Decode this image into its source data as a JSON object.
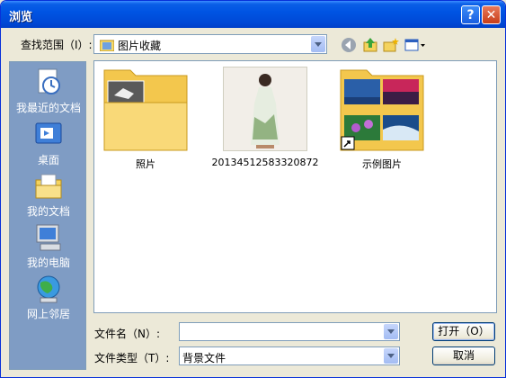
{
  "window": {
    "title": "浏览"
  },
  "titlebar": {
    "help": "?",
    "close": "✕"
  },
  "lookin": {
    "label": "查找范围（I）:",
    "value": "图片收藏"
  },
  "toolbar": {
    "icons": [
      "back-icon",
      "up-folder-icon",
      "new-folder-icon",
      "views-icon"
    ]
  },
  "places": [
    {
      "label": "我最近的文档",
      "icon": "recent-documents-icon"
    },
    {
      "label": "桌面",
      "icon": "desktop-icon"
    },
    {
      "label": "我的文档",
      "icon": "my-documents-icon"
    },
    {
      "label": "我的电脑",
      "icon": "my-computer-icon"
    },
    {
      "label": "网上邻居",
      "icon": "network-places-icon"
    }
  ],
  "items": [
    {
      "name": "照片",
      "type": "folder"
    },
    {
      "name": "20134512583320872",
      "type": "image"
    },
    {
      "name": "示例图片",
      "type": "shortcut-folder"
    }
  ],
  "filename": {
    "label": "文件名（N）:",
    "value": ""
  },
  "filetype": {
    "label": "文件类型（T）:",
    "value": "背景文件"
  },
  "buttons": {
    "open": "打开（O）",
    "cancel": "取消"
  },
  "colors": {
    "title_bar": "#0054e3",
    "places_bar": "#7f9cc4",
    "dialog_bg": "#ece9d8"
  }
}
